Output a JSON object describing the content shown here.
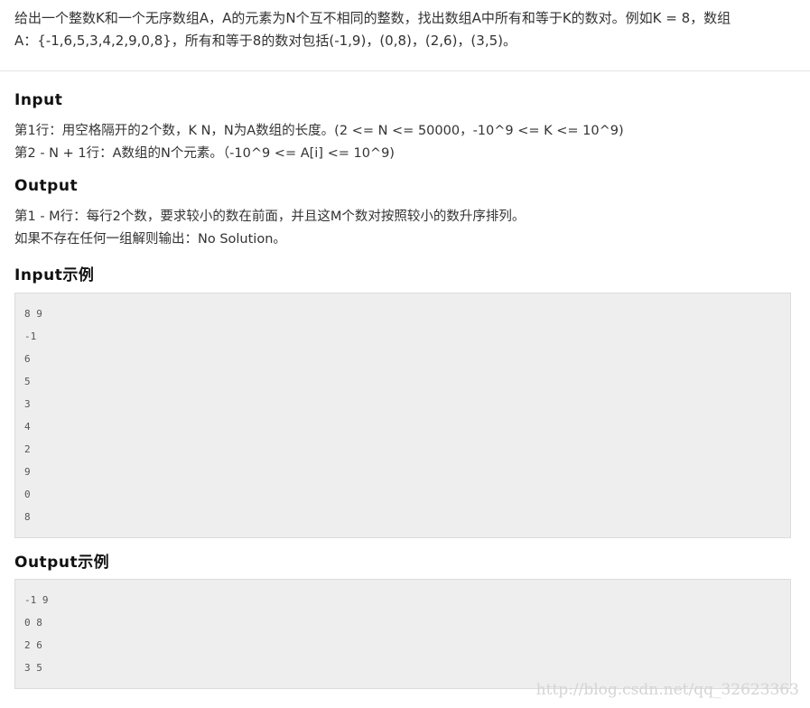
{
  "description": {
    "line1": "给出一个整数K和一个无序数组A，A的元素为N个互不相同的整数，找出数组A中所有和等于K的数对。例如K = 8，数组",
    "line2": "A：{-1,6,5,3,4,2,9,0,8}，所有和等于8的数对包括(-1,9)，(0,8)，(2,6)，(3,5)。"
  },
  "input_section": {
    "heading": "Input",
    "lines": [
      "第1行：用空格隔开的2个数，K N，N为A数组的长度。(2 <= N <= 50000，-10^9 <= K <= 10^9)",
      "第2 - N + 1行：A数组的N个元素。（-10^9 <= A[i] <= 10^9)"
    ]
  },
  "output_section": {
    "heading": "Output",
    "lines": [
      "第1 - M行：每行2个数，要求较小的数在前面，并且这M个数对按照较小的数升序排列。",
      "如果不存在任何一组解则输出：No Solution。"
    ]
  },
  "input_example": {
    "heading": "Input示例",
    "lines": [
      "8 9",
      "-1",
      "6",
      "5",
      "3",
      "4",
      "2",
      "9",
      "0",
      "8"
    ]
  },
  "output_example": {
    "heading": "Output示例",
    "lines": [
      "-1 9",
      "0 8",
      "2 6",
      "3 5"
    ]
  },
  "watermark": "http://blog.csdn.net/qq_32623363"
}
